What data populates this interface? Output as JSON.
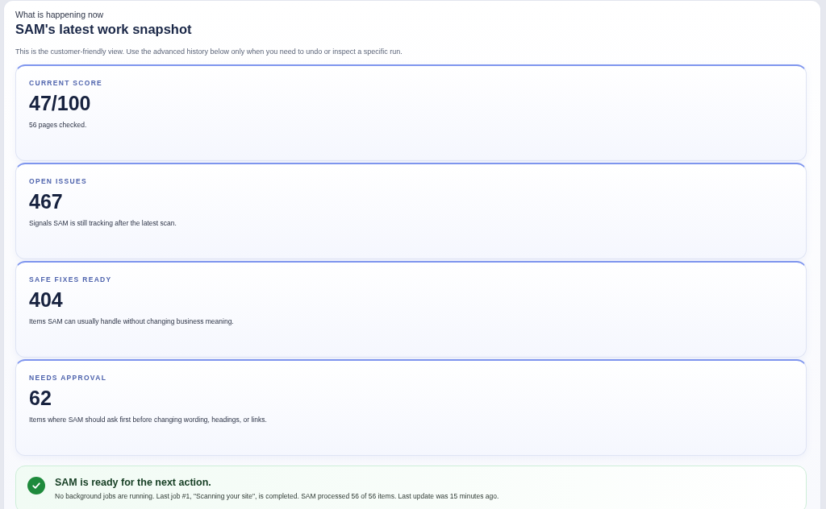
{
  "header": {
    "eyebrow": "What is happening now",
    "title": "SAM's latest work snapshot",
    "description": "This is the customer-friendly view. Use the advanced history below only when you need to undo or inspect a specific run."
  },
  "metrics": [
    {
      "label": "CURRENT SCORE",
      "value": "47/100",
      "description": "56 pages checked."
    },
    {
      "label": "OPEN ISSUES",
      "value": "467",
      "description": "Signals SAM is still tracking after the latest scan."
    },
    {
      "label": "SAFE FIXES READY",
      "value": "404",
      "description": "Items SAM can usually handle without changing business meaning."
    },
    {
      "label": "NEEDS APPROVAL",
      "value": "62",
      "description": "Items where SAM should ask first before changing wording, headings, or links."
    }
  ],
  "status": {
    "kind": "success",
    "title": "SAM is ready for the next action.",
    "message": "No background jobs are running. Last job #1, \"Scanning your site\", is completed. SAM processed 56 of 56 items. Last update was 15 minutes ago."
  }
}
